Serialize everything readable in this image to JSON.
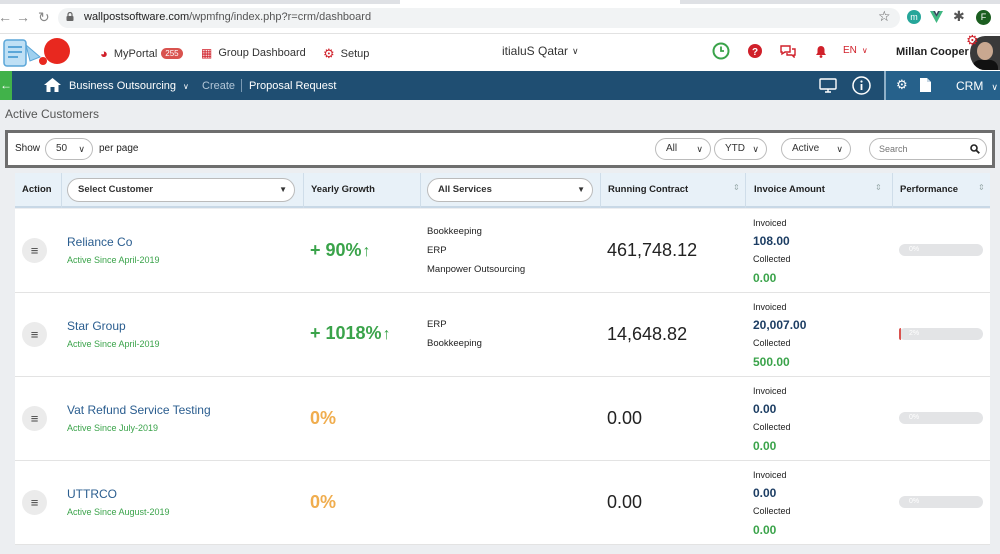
{
  "browser": {
    "url_host": "wallpostsoftware.com",
    "url_path": "/wpmfng/index.php?r=crm/dashboard",
    "ext_letter": "F",
    "ext_m": "m"
  },
  "header": {
    "myportal_label": "MyPortal",
    "myportal_badge": "255",
    "group_dashboard_label": "Group Dashboard",
    "setup_label": "Setup",
    "company": "itialuS Qatar",
    "lang": "EN",
    "user_name": "Millan Cooper",
    "colors": {
      "accent_red": "#d0202a",
      "clock_green": "#3aa34a"
    }
  },
  "navbar": {
    "module": "Business Outsourcing",
    "create": "Create",
    "proposal": "Proposal Request",
    "crm": "CRM"
  },
  "page": {
    "title": "Active Customers"
  },
  "filters": {
    "show_label": "Show",
    "per_page_value": "50",
    "per_page_label": "per page",
    "scope": "All",
    "period": "YTD",
    "status": "Active",
    "search_placeholder": "Search"
  },
  "table": {
    "headers": {
      "action": "Action",
      "customer_select": "Select Customer",
      "yearly_growth": "Yearly Growth",
      "services_select": "All Services",
      "running_contract": "Running Contract",
      "invoice_amount": "Invoice Amount",
      "performance": "Performance"
    },
    "rows": [
      {
        "name": "Reliance Co",
        "since": "Active Since April-2019",
        "growth": "+ 90%",
        "growth_arrow": "↑",
        "services": [
          "Bookkeeping",
          "ERP",
          "Manpower Outsourcing"
        ],
        "contract": "461,748.12",
        "invoiced_label": "Invoiced",
        "invoiced": "108.00",
        "collected_label": "Collected",
        "collected": "0.00",
        "performance": "0%",
        "performance_value": 0
      },
      {
        "name": "Star Group",
        "since": "Active Since April-2019",
        "growth": "+ 1018%",
        "growth_arrow": "↑",
        "services": [
          "ERP",
          "Bookkeeping"
        ],
        "contract": "14,648.82",
        "invoiced_label": "Invoiced",
        "invoiced": "20,007.00",
        "collected_label": "Collected",
        "collected": "500.00",
        "performance": "2%",
        "performance_value": 2
      },
      {
        "name": "Vat Refund Service Testing",
        "since": "Active Since July-2019",
        "growth": "0%",
        "growth_arrow": "",
        "services": [],
        "contract": "0.00",
        "invoiced_label": "Invoiced",
        "invoiced": "0.00",
        "collected_label": "Collected",
        "collected": "0.00",
        "performance": "0%",
        "performance_value": 0
      },
      {
        "name": "UTTRCO",
        "since": "Active Since August-2019",
        "growth": "0%",
        "growth_arrow": "",
        "services": [],
        "contract": "0.00",
        "invoiced_label": "Invoiced",
        "invoiced": "0.00",
        "collected_label": "Collected",
        "collected": "0.00",
        "performance": "0%",
        "performance_value": 0
      }
    ],
    "colors": {
      "growth_positive": "#3aa34a",
      "growth_zero": "#f0ad4e",
      "customer_link": "#2a5d8f"
    }
  }
}
